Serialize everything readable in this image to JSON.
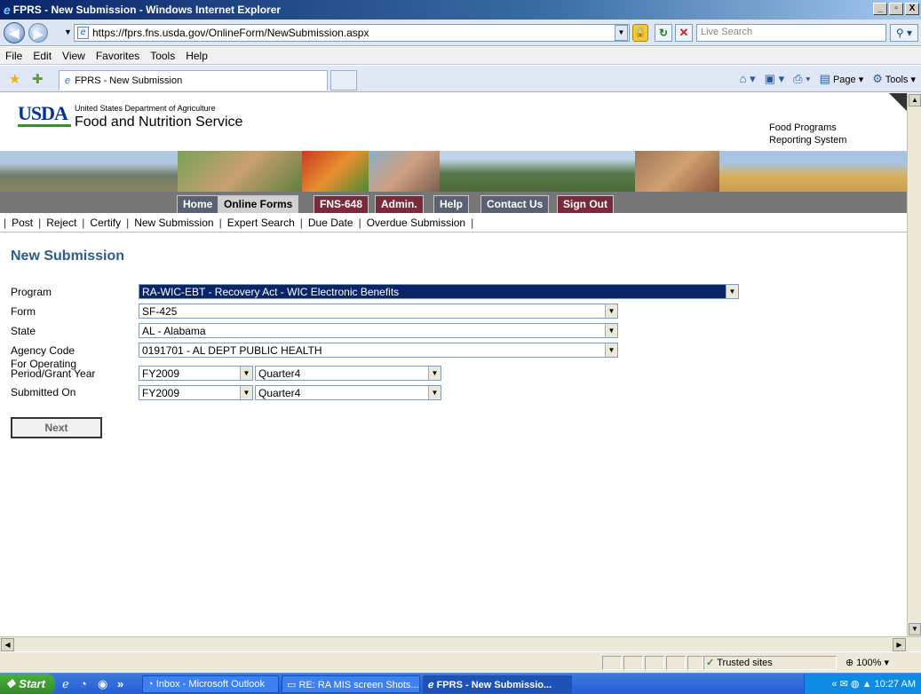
{
  "window": {
    "title": "FPRS - New Submission - Windows Internet Explorer",
    "minimize": "_",
    "maximize": "▫",
    "close": "X"
  },
  "addressbar": {
    "url": "https://fprs.fns.usda.gov/OnlineForm/NewSubmission.aspx",
    "search_placeholder": "Live Search"
  },
  "menu": [
    "File",
    "Edit",
    "View",
    "Favorites",
    "Tools",
    "Help"
  ],
  "tab": {
    "title": "FPRS - New Submission"
  },
  "commandbar": {
    "page": "Page",
    "tools": "Tools"
  },
  "site": {
    "logo_text": "USDA",
    "dept": "United States Department of Agriculture",
    "agency": "Food and Nutrition Service",
    "system_line1": "Food Programs",
    "system_line2": "Reporting System"
  },
  "nav": {
    "items": [
      "Home",
      "Online Forms",
      "FNS-648",
      "Admin.",
      "Help",
      "Contact Us",
      "Sign Out"
    ]
  },
  "subnav": {
    "items": [
      "Post",
      "Reject",
      "Certify",
      "New Submission",
      "Expert Search",
      "Due Date",
      "Overdue Submission"
    ]
  },
  "form": {
    "title": "New Submission",
    "program_label": "Program",
    "program_value": "RA-WIC-EBT - Recovery Act - WIC Electronic Benefits",
    "form_label": "Form",
    "form_value": "SF-425",
    "state_label": "State",
    "state_value": "AL - Alabama",
    "agency_label": "Agency Code",
    "agency_value": "0191701 - AL DEPT PUBLIC HEALTH",
    "period_label_line1": "For Operating",
    "period_label_line2": "Period/Grant Year",
    "period_year": "FY2009",
    "period_quarter": "Quarter4",
    "submitted_label": "Submitted On",
    "submitted_year": "FY2009",
    "submitted_quarter": "Quarter4",
    "next_label": "Next"
  },
  "statusbar": {
    "zone": "Trusted sites",
    "zoom": "100%"
  },
  "taskbar": {
    "start": "Start",
    "tasks": [
      "Inbox - Microsoft Outlook",
      "RE: RA MIS screen Shots...",
      "FPRS - New Submissio..."
    ],
    "time": "10:27 AM"
  },
  "colors": {
    "title_accent": "#2f5a8a",
    "nav_bg": "#5a6170",
    "selection": "#0a246a"
  }
}
